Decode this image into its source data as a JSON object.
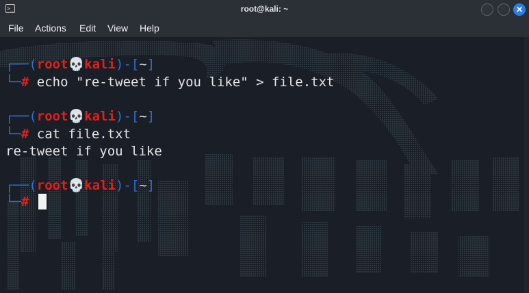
{
  "window": {
    "title": "root@kali: ~",
    "close_glyph": "✕"
  },
  "menu": {
    "items": [
      "File",
      "Actions",
      "Edit",
      "View",
      "Help"
    ]
  },
  "prompt": {
    "open_paren": "(",
    "user": "root",
    "skull": "💀",
    "host": "kali",
    "close_paren": ")",
    "dash": "-",
    "dir_open": "[",
    "dir": "~",
    "dir_close": "]",
    "hash": "#"
  },
  "session": {
    "cmd1": " echo \"re-tweet if you like\" > file.txt",
    "cmd2": " cat file.txt",
    "output2": "re-tweet if you like",
    "cmd3": " "
  },
  "colors": {
    "background": "#1a1e26",
    "prompt_blue": "#2f6fd6",
    "prompt_red": "#e1201c",
    "text": "#e6e6e6",
    "close_button": "#2b7fe8"
  }
}
